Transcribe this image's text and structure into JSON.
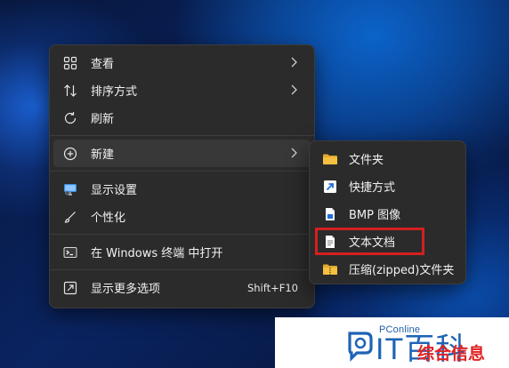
{
  "colors": {
    "menu_bg": "#2b2b2b",
    "folder": "#f5c042",
    "shortcut_arrow": "#4aa3ff",
    "highlight_border": "#d42020",
    "watermark_blue": "#1e63b5",
    "watermark_red": "#e02323"
  },
  "context_menu": {
    "items": [
      {
        "label": "查看",
        "icon": "grid-icon"
      },
      {
        "label": "排序方式",
        "icon": "sort-icon"
      },
      {
        "label": "刷新",
        "icon": "refresh-icon"
      },
      {
        "label": "新建",
        "icon": "new-plus-icon"
      },
      {
        "label": "显示设置",
        "icon": "display-icon"
      },
      {
        "label": "个性化",
        "icon": "brush-icon"
      },
      {
        "label": "在 Windows 终端 中打开",
        "icon": "terminal-icon"
      },
      {
        "label": "显示更多选项",
        "icon": "more-options-icon",
        "shortcut": "Shift+F10"
      }
    ]
  },
  "new_submenu": {
    "items": [
      {
        "label": "文件夹",
        "icon": "folder-icon"
      },
      {
        "label": "快捷方式",
        "icon": "shortcut-icon"
      },
      {
        "label": "BMP 图像",
        "icon": "bmp-image-icon"
      },
      {
        "label": "文本文档",
        "icon": "text-document-icon",
        "highlighted": true
      },
      {
        "label": "压缩(zipped)文件夹",
        "icon": "zip-folder-icon"
      }
    ]
  },
  "watermark": {
    "brand": "PConline",
    "logo_text": "IT百科",
    "info": "综合信息"
  }
}
